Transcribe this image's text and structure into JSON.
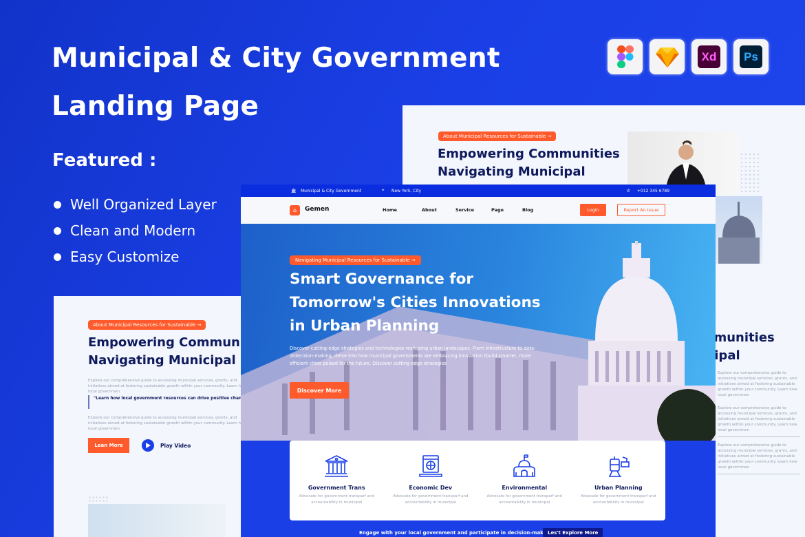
{
  "promo": {
    "title_line1": "Municipal & City Government",
    "title_line2": "Landing Page",
    "featured": "Featured :",
    "features": [
      "Well Organized Layer",
      "Clean and Modern",
      "Easy Customize"
    ],
    "tools": [
      {
        "name": "figma-icon"
      },
      {
        "name": "sketch-icon"
      },
      {
        "name": "xd-icon",
        "label": "Xd",
        "color": "#470137",
        "text_color": "#ff61f6"
      },
      {
        "name": "photoshop-icon",
        "label": "Ps",
        "color": "#001e36",
        "text_color": "#31a8ff"
      }
    ]
  },
  "back_card": {
    "badge": "About Municipal Resources for Sustainable",
    "heading_line1": "Empowering Communities",
    "heading_line2": "Navigating Municipal",
    "desc": "Explore our comprehensive guide to accessing municipal services, grants, and initiatives aimed at fostering sustainable growth within your community. Learn how local governmen"
  },
  "left_card": {
    "badge": "About Municipal Resources for Sustainable",
    "heading_line1": "Empowering Communities",
    "heading_line2": "Navigating Municipal",
    "desc": "Explore our comprehensive guide to accessing municipal services, grants, and initiatives aimed at fostering sustainable growth within your community. Learn how local governmen",
    "quote": "\"Learn how local government resources can drive positive change and enhance the quality of life for all residents. Learn how local government resources",
    "desc2": "Explore our comprehensive guide to accessing municipal services, grants, and initiatives aimed at fostering sustainable growth within your community. Learn how local governmen",
    "learn_more": "Lean More",
    "play_video": "Play Video"
  },
  "site": {
    "topbar": {
      "org": "Municipal & City Government",
      "location": "New York, City",
      "phone": "+012 345 6789"
    },
    "logo": "Gemen",
    "nav": [
      "Home",
      "About",
      "Service",
      "Page",
      "Blog"
    ],
    "login": "Login",
    "report": "Report An Issue",
    "hero": {
      "badge": "Navigating Municipal Resources for Sustainable",
      "title_line1": "Smart Governance for",
      "title_line2": "Tomorrow's Cities Innovations",
      "title_line3": "in Urban Planning",
      "desc": "Discover cutting-edge strategies and technologies reshoping urban landscapes. From infrastructure to data-drdecision-making, delve into how municipal governments are embracing innovation tbuild smarter, more efficient cities poised for the future. Discover cutting-edge strategies",
      "cta": "Discover More"
    },
    "services": [
      {
        "title": "Government Trans",
        "desc": "Advocate for government transparf and accountability in municipal",
        "icon": "bank-icon"
      },
      {
        "title": "Economic Dev",
        "desc": "Advocate for government transparf and accountability in municipal",
        "icon": "laptop-globe-icon"
      },
      {
        "title": "Environmental",
        "desc": "Advocate for government transparf and accountability in municipal",
        "icon": "capitol-icon"
      },
      {
        "title": "Urban Planning",
        "desc": "Advocate for government transparf and accountability in municipal",
        "icon": "tram-icon"
      }
    ],
    "bottom": {
      "text": "Engage with your local government and participate in decision-making",
      "cta": "Les't Explore More"
    }
  },
  "colors": {
    "brand_blue": "#1a3fe6",
    "accent": "#ff5a2c",
    "navy": "#0e1a5c"
  }
}
